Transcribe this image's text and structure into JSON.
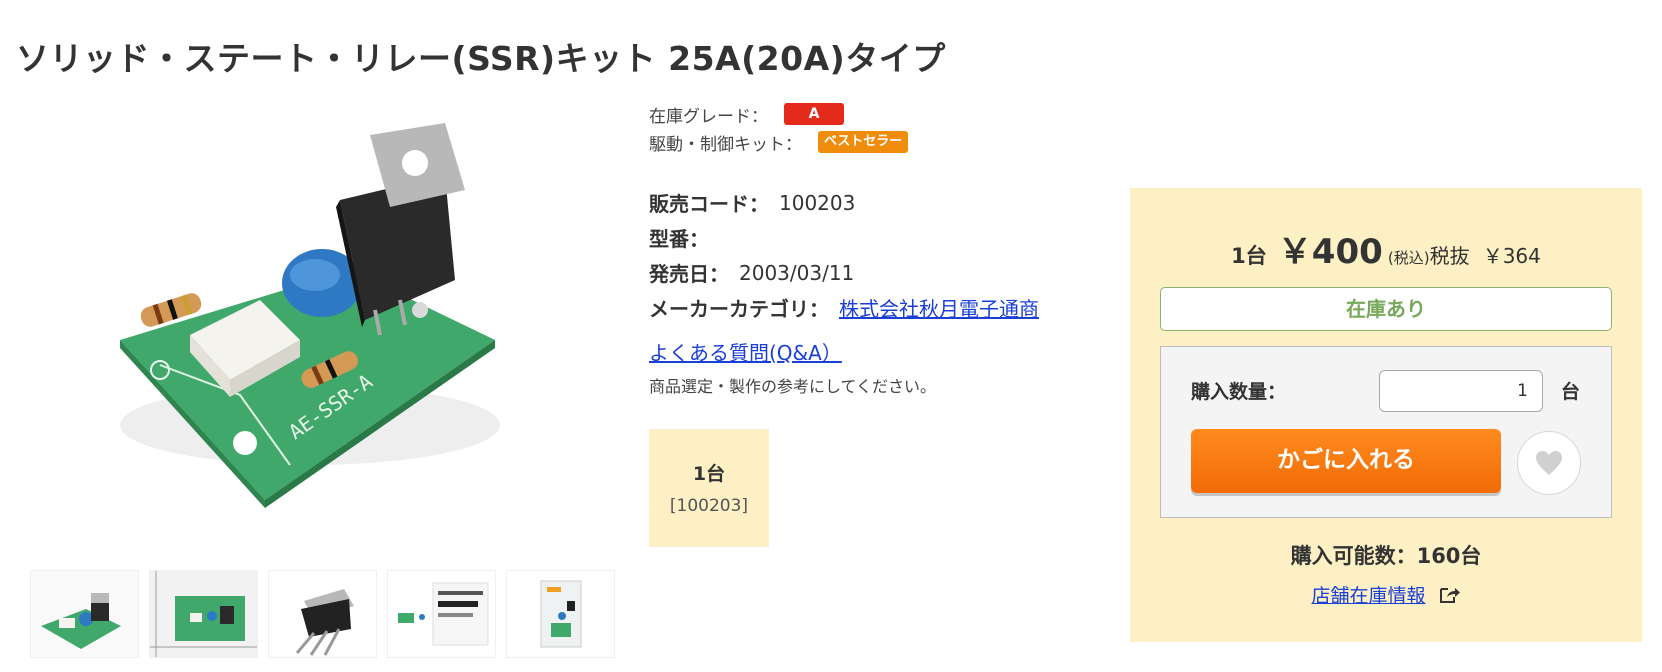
{
  "product": {
    "title": "ソリッド・ステート・リレー(SSR)キット 25A(20A)タイプ"
  },
  "grades": {
    "stock_grade_label": "在庫グレード：",
    "stock_grade_value": "A",
    "category_label": "駆動・制御キット：",
    "category_badge": "ベストセラー"
  },
  "specs": {
    "sales_code_label": "販売コード：",
    "sales_code_value": "100203",
    "model_label": "型番：",
    "model_value": "",
    "release_label": "発売日：",
    "release_value": "2003/03/11",
    "maker_label": "メーカーカテゴリ：",
    "maker_value": "株式会社秋月電子通商"
  },
  "faq": {
    "link": "よくある質問(Q&A）",
    "note": "商品選定・製作の参考にしてください。"
  },
  "unit_option": {
    "name": "1台",
    "code": "[100203]"
  },
  "purchase": {
    "unit": "1台",
    "price": "￥400",
    "tax_note": "(税込)",
    "tax_excluded_label": "税抜",
    "tax_excluded_price": "￥364",
    "stock_status": "在庫あり",
    "qty_label": "購入数量：",
    "qty_value": "1",
    "qty_unit": "台",
    "cart_button": "かごに入れる",
    "available_qty": "購入可能数：160台",
    "store_stock_link": "店舗在庫情報"
  },
  "icons": {
    "favorite": "heart-icon",
    "external": "external-link-icon"
  },
  "colors": {
    "grade_badge": "#e42a1b",
    "bestseller_badge": "#f08c0c",
    "panel_bg": "#fdf0c4",
    "cart_button": "#f7780f",
    "stock_text": "#78a85a",
    "link": "#1a3fd6"
  }
}
